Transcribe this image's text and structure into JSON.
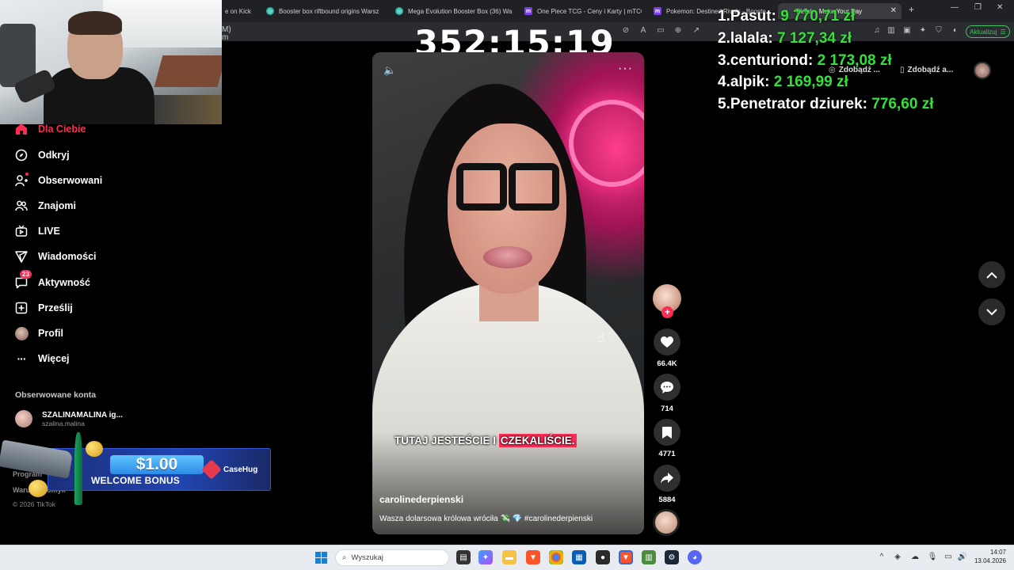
{
  "browser": {
    "tabs": [
      {
        "label": "e on Kick",
        "favicon": "kick-icon",
        "color": "#53fc18"
      },
      {
        "label": "Booster box riftbound origins Warsz",
        "favicon": "globe-icon",
        "color": "#2bb5a8"
      },
      {
        "label": "Mega Evolution Booster Box (36) Wa",
        "favicon": "globe-icon",
        "color": "#2bb5a8"
      },
      {
        "label": "One Piece TCG - Ceny i Karty | mTCG",
        "favicon": "m-icon",
        "color": "#7b3fe4"
      },
      {
        "label": "Pokemon: Destined Rivals - Booster",
        "favicon": "m-icon",
        "color": "#7b3fe4"
      },
      {
        "label": "TikTok - Make Your Day",
        "favicon": "tiktok-icon",
        "color": "#ffffff"
      }
    ],
    "address_fragment": "M)\nm",
    "update_label": "Aktualizuj"
  },
  "overlay": {
    "timer": "352:15:19",
    "leaderboard": [
      {
        "rank": "1.",
        "name": "Pasut:",
        "amount": "9 770,71 zł"
      },
      {
        "rank": "2.",
        "name": "lalala:",
        "amount": "7 127,34 zł"
      },
      {
        "rank": "3.",
        "name": "centuriond:",
        "amount": "2 173,08 zł"
      },
      {
        "rank": "4.",
        "name": "alpik:",
        "amount": "2 169,99 zł"
      },
      {
        "rank": "5.",
        "name": "Penetrator dziurek:",
        "amount": "776,60 zł"
      }
    ]
  },
  "header": {
    "get_app_1": "Zdobądź ...",
    "get_app_2": "Zdobądź a..."
  },
  "sidebar": {
    "items": [
      {
        "label": "Dla Ciebie",
        "icon": "home-icon"
      },
      {
        "label": "Odkryj",
        "icon": "compass-icon"
      },
      {
        "label": "Obserwowani",
        "icon": "user-follow-icon"
      },
      {
        "label": "Znajomi",
        "icon": "friends-icon"
      },
      {
        "label": "LIVE",
        "icon": "live-tv-icon"
      },
      {
        "label": "Wiadomości",
        "icon": "send-icon"
      },
      {
        "label": "Aktywność",
        "icon": "chat-bubble-icon",
        "badge": "23"
      },
      {
        "label": "Prześlij",
        "icon": "upload-plus-icon"
      },
      {
        "label": "Profil",
        "icon": "profile-avatar"
      },
      {
        "label": "Więcej",
        "icon": "more-dots-icon"
      }
    ],
    "followed_title": "Obserwowane konta",
    "followed": [
      {
        "name": "SZALINAMALINA ig...",
        "handle": "szalina.malina"
      }
    ],
    "footer": [
      "Program",
      "Warunki polityk",
      "© 2026 TikTok"
    ]
  },
  "banner": {
    "amount": "$1.00",
    "subtitle": "WELCOME BONUS",
    "brand": "CaseHug"
  },
  "video": {
    "caption_plain": "TUTAJ JESTEŚCIE I ",
    "caption_highlight": "CZEKALIŚCIE.",
    "username": "carolinederpienski",
    "description": "Wasza dolarsowa królowa wróciła 💸 💎 #carolinederpienski"
  },
  "actions": {
    "likes": "66.4K",
    "comments": "714",
    "saves": "4771",
    "shares": "5884"
  },
  "taskbar": {
    "search_placeholder": "Wyszukaj",
    "time": "14:07",
    "date": "13.04.2026"
  },
  "colors": {
    "accent": "#fe2c55",
    "money": "#34e03a",
    "update": "#41c463"
  }
}
